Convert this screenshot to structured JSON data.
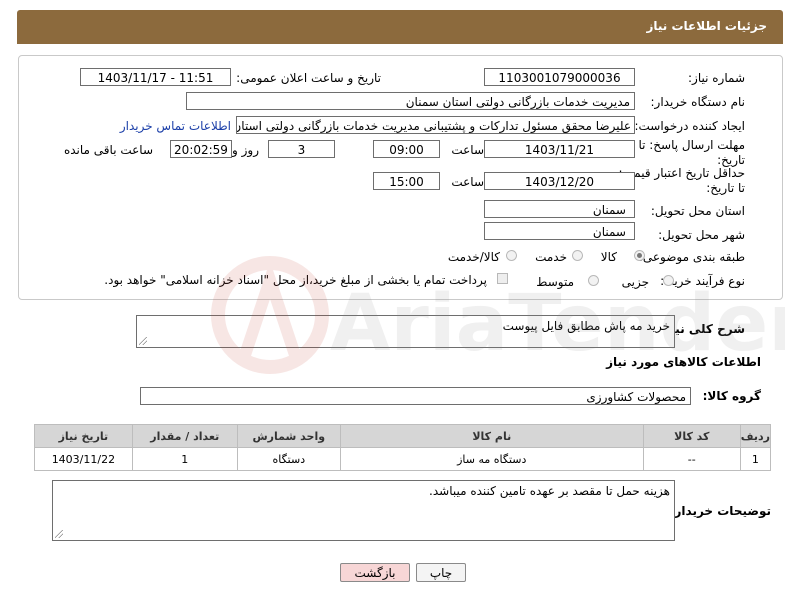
{
  "header": {
    "title": "جزئیات اطلاعات نیاز"
  },
  "form": {
    "need_number_label": "شماره نیاز:",
    "need_number": "1103001079000036",
    "announce_label": "تاریخ و ساعت اعلان عمومی:",
    "announce_value": "1403/11/17 - 11:51",
    "buyer_org_label": "نام دستگاه خریدار:",
    "buyer_org": "مدیریت خدمات بازرگانی دولتی استان سمنان",
    "creator_label": "ایجاد کننده درخواست:",
    "creator": "علیرضا محقق مسئول تدارکات و پشتیبانی مدیریت خدمات بازرگانی دولتی استان",
    "contact_link": "اطلاعات تماس خریدار",
    "reply_deadline_label": "مهلت ارسال پاسخ: تا تاریخ:",
    "reply_date": "1403/11/21",
    "time_label": "ساعت",
    "reply_time": "09:00",
    "days": "3",
    "days_label": "روز و",
    "remaining": "20:02:59",
    "remaining_label": "ساعت باقی مانده",
    "price_deadline_label": "حداقل تاریخ اعتبار قیمت: تا تاریخ:",
    "price_date": "1403/12/20",
    "price_time": "15:00",
    "province_label": "استان محل تحویل:",
    "province": "سمنان",
    "city_label": "شهر محل تحویل:",
    "city": "سمنان",
    "category_label": "طبقه بندی موضوعی:",
    "category_options": [
      "کالا",
      "خدمت",
      "کالا/خدمت"
    ],
    "purchase_type_label": "نوع فرآیند خرید :",
    "purchase_options": [
      "جزیی",
      "متوسط"
    ],
    "payment_note": "پرداخت تمام یا بخشی از مبلغ خرید،از محل \"اسناد خزانه اسلامی\" خواهد بود."
  },
  "description": {
    "label": "شرح کلی نیاز:",
    "value": "خرید مه پاش مطابق فایل پیوست"
  },
  "goods": {
    "section_title": "اطلاعات کالاهای مورد نیاز",
    "group_label": "گروه کالا:",
    "group_value": "محصولات کشاورزی",
    "columns": [
      "ردیف",
      "کد کالا",
      "نام کالا",
      "واحد شمارش",
      "تعداد / مقدار",
      "تاریخ نیاز"
    ],
    "rows": [
      [
        "1",
        "--",
        "دستگاه مه ساز",
        "دستگاه",
        "1",
        "1403/11/22"
      ]
    ]
  },
  "buyer_notes": {
    "label": "توضیحات خریدار:",
    "value": "هزینه حمل تا مقصد بر عهده تامین کننده میباشد."
  },
  "buttons": {
    "print": "چاپ",
    "back": "بازگشت"
  },
  "watermark": {
    "text": "AriaTender.net"
  },
  "colors": {
    "header": "#8c6a3d",
    "link": "#1a3ea8",
    "back_button_bg": "#f7d6d6"
  }
}
